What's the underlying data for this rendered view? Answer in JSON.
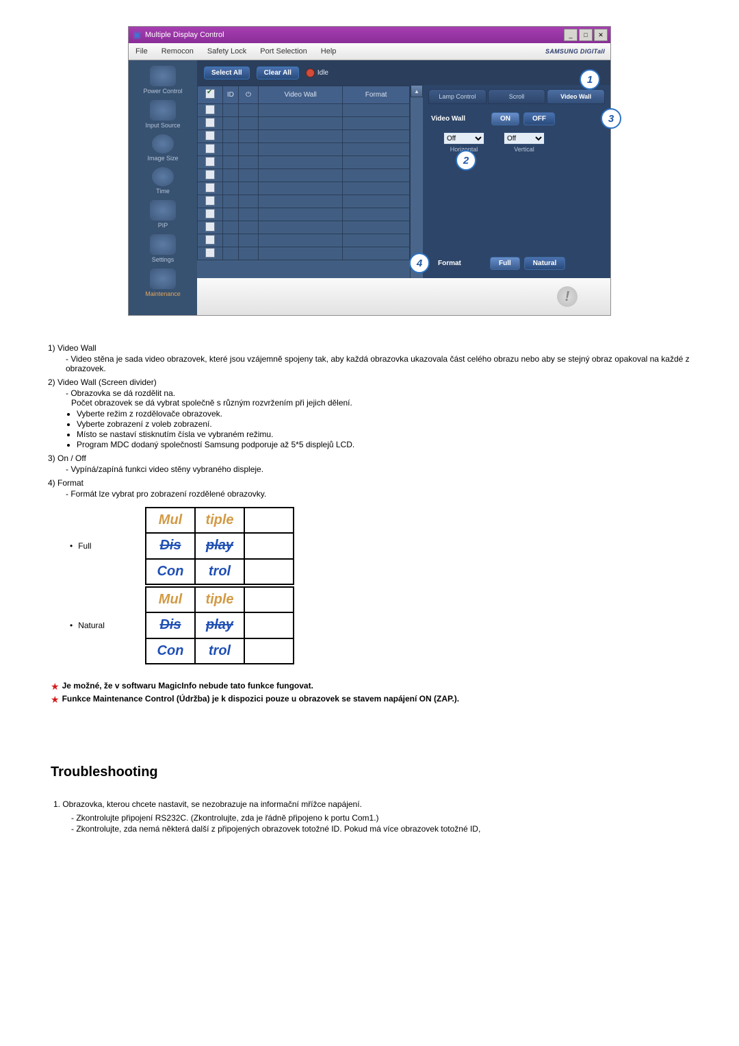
{
  "shot": {
    "title": "Multiple Display Control",
    "menus": [
      "File",
      "Remocon",
      "Safety Lock",
      "Port Selection",
      "Help"
    ],
    "brand": "SAMSUNG DIGITall",
    "sidebar": [
      {
        "label": "Power Control"
      },
      {
        "label": "Input Source"
      },
      {
        "label": "Image Size"
      },
      {
        "label": "Time"
      },
      {
        "label": "PIP"
      },
      {
        "label": "Settings"
      },
      {
        "label": "Maintenance"
      }
    ],
    "topbtns": {
      "select": "Select All",
      "clear": "Clear All",
      "idle": "Idle"
    },
    "grid_headers": {
      "check": "✔",
      "id": "ID",
      "power": "",
      "vw": "Video Wall",
      "format": "Format"
    },
    "rpanel": {
      "tabs": [
        "Lamp Control",
        "Scroll",
        "Video Wall"
      ],
      "videowall_label": "Video Wall",
      "on": "ON",
      "off": "OFF",
      "horiz_val": "Off",
      "horiz_cap": "Horizontal",
      "vert_val": "Off",
      "vert_cap": "Vertical",
      "format_label": "Format",
      "full": "Full",
      "natural": "Natural"
    },
    "markers": {
      "m1": "1",
      "m2": "2",
      "m3": "3",
      "m4": "4"
    }
  },
  "body": {
    "i1_t": "1) Video Wall",
    "i1_s": "- Video stěna je sada video obrazovek, které jsou vzájemně spojeny tak, aby každá obrazovka ukazovala část celého obrazu nebo aby se stejný obraz opakoval na každé z obrazovek.",
    "i2_t": "2) Video Wall (Screen divider)",
    "i2_s1": "- Obrazovka se dá rozdělit na.",
    "i2_s2": "Počet obrazovek se dá vybrat společně s různým rozvržením při jejich dělení.",
    "i2_b": [
      "Vyberte režim z rozdělovače obrazovek.",
      "Vyberte zobrazení z voleb zobrazení.",
      "Místo se nastaví stisknutím čísla ve vybraném režimu.",
      "Program MDC dodaný společností Samsung podporuje až 5*5 displejů LCD."
    ],
    "i3_t": "3) On / Off",
    "i3_s": "- Vypíná/zapíná funkci video stěny vybraného displeje.",
    "i4_t": "4) Format",
    "i4_s": "- Formát lze vybrat pro zobrazení rozdělené obrazovky.",
    "fmt_full": "Full",
    "fmt_nat": "Natural",
    "mdc": {
      "l1": "Multiple",
      "l2": "Display",
      "l3": "Control"
    },
    "note1": "Je možné, že v softwaru MagicInfo nebude tato funkce fungovat.",
    "note2": "Funkce Maintenance Control (Údržba) je k dispozici pouze u obrazovek se stavem napájení ON (ZAP.).",
    "h2": "Troubleshooting",
    "ts1": "1. Obrazovka, kterou chcete nastavit, se nezobrazuje na informační mřížce napájení.",
    "ts1a": "- Zkontrolujte připojení RS232C. (Zkontrolujte, zda je řádně připojeno k portu Com1.)",
    "ts1b": "- Zkontrolujte, zda nemá některá další z připojených obrazovek totožné ID. Pokud má více obrazovek totožné ID,"
  }
}
